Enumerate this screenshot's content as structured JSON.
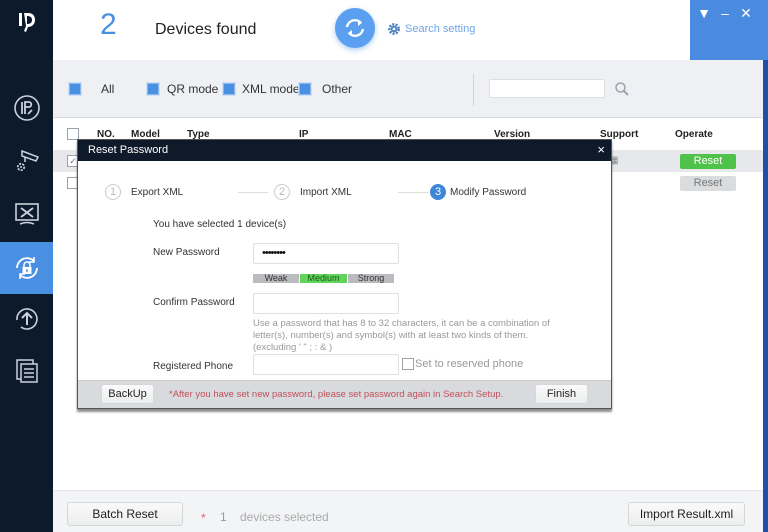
{
  "header": {
    "device_count": "2",
    "devices_found_label": "Devices found",
    "search_setting_label": "Search setting"
  },
  "window_controls": {
    "menu": "▼",
    "minimize": "–",
    "close": "✕"
  },
  "sidebar": {
    "items": [
      {
        "icon": "ip-icon",
        "active": false
      },
      {
        "icon": "camera-settings-icon",
        "active": false
      },
      {
        "icon": "tools-monitor-icon",
        "active": false
      },
      {
        "icon": "password-reset-icon",
        "active": true
      },
      {
        "icon": "upgrade-icon",
        "active": false
      },
      {
        "icon": "documents-icon",
        "active": false
      }
    ]
  },
  "filter": {
    "all_label": "All",
    "qr_label": "QR mode",
    "xml_label": "XML mode",
    "other_label": "Other",
    "search_placeholder": ""
  },
  "table": {
    "columns": [
      "NO.",
      "Model",
      "Type",
      "IP",
      "MAC",
      "Version",
      "Support",
      "Operate"
    ],
    "rows": [
      {
        "checked": true,
        "operate_label": "Reset",
        "operate_enabled": true
      },
      {
        "checked": false,
        "operate_label": "Reset",
        "operate_enabled": false
      }
    ]
  },
  "bottom": {
    "batch_reset_label": "Batch Reset",
    "star": "*",
    "selected_count": "1",
    "selected_text": "devices selected",
    "import_label": "Import Result.xml"
  },
  "dialog": {
    "title": "Reset Password",
    "close": "×",
    "steps": [
      {
        "num": "1",
        "label": "Export XML",
        "active": false
      },
      {
        "num": "2",
        "label": "Import XML",
        "active": false
      },
      {
        "num": "3",
        "label": "Modify Password",
        "active": true
      }
    ],
    "selected_text": "You have selected 1 device(s)",
    "new_password_label": "New Password",
    "new_password_value": "••••••••",
    "strength": {
      "weak": "Weak",
      "medium": "Medium",
      "strong": "Strong",
      "current": "Medium"
    },
    "confirm_password_label": "Confirm Password",
    "confirm_password_value": "",
    "hint": "Use a password that has 8 to 32 characters, it can be a combination of letter(s), number(s) and symbol(s) with at least two kinds of them. (excluding ' \" ; : & )",
    "phone_label": "Registered Phone",
    "phone_value": "",
    "reserve_label": "Set to reserved phone",
    "backup_label": "BackUp",
    "warning": "*After you have set new password, please set password again in Search Setup.",
    "finish_label": "Finish"
  },
  "colors": {
    "accent": "#4a90e2",
    "sidebar_bg": "#0d1a2b",
    "reset_green": "#4fc24a",
    "warning_red": "#c0505a",
    "strength_medium": "#5fd35a"
  }
}
